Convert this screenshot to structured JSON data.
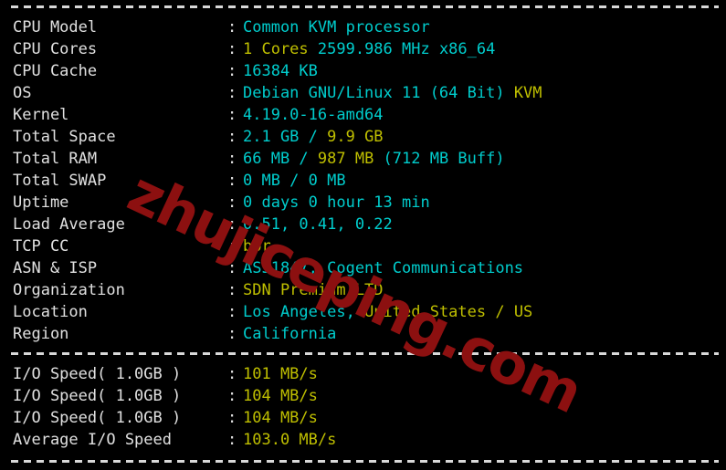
{
  "terminal": {
    "background": "#000000",
    "colors": {
      "label": "#e0e0e0",
      "cyan": "#00cdcd",
      "yellow": "#bfbf00",
      "watermark": "#8c1010"
    },
    "separator_char": "-",
    "colon": ":"
  },
  "watermark": {
    "text": "zhujiceping.com"
  },
  "system_info": [
    {
      "label": "CPU Model",
      "segments": [
        {
          "text": "Common KVM processor",
          "color": "cyan"
        }
      ]
    },
    {
      "label": "CPU Cores",
      "segments": [
        {
          "text": "1 Cores ",
          "color": "yellow"
        },
        {
          "text": "2599.986 MHz x86_64",
          "color": "cyan"
        }
      ]
    },
    {
      "label": "CPU Cache",
      "segments": [
        {
          "text": "16384 KB",
          "color": "cyan"
        }
      ]
    },
    {
      "label": "OS",
      "segments": [
        {
          "text": "Debian GNU/Linux 11 (64 Bit) ",
          "color": "cyan"
        },
        {
          "text": "KVM",
          "color": "yellow"
        }
      ]
    },
    {
      "label": "Kernel",
      "segments": [
        {
          "text": "4.19.0-16-amd64",
          "color": "cyan"
        }
      ]
    },
    {
      "label": "Total Space",
      "segments": [
        {
          "text": "2.1 GB / ",
          "color": "cyan"
        },
        {
          "text": "9.9 GB",
          "color": "yellow"
        }
      ]
    },
    {
      "label": "Total RAM",
      "segments": [
        {
          "text": "66 MB / ",
          "color": "cyan"
        },
        {
          "text": "987 MB ",
          "color": "yellow"
        },
        {
          "text": "(712 MB Buff)",
          "color": "cyan"
        }
      ]
    },
    {
      "label": "Total SWAP",
      "segments": [
        {
          "text": "0 MB / ",
          "color": "cyan"
        },
        {
          "text": "0 MB",
          "color": "cyan"
        }
      ]
    },
    {
      "label": "Uptime",
      "segments": [
        {
          "text": "0 days 0 hour 13 min",
          "color": "cyan"
        }
      ]
    },
    {
      "label": "Load Average",
      "segments": [
        {
          "text": "0.51, 0.41, 0.22",
          "color": "cyan"
        }
      ]
    },
    {
      "label": "TCP CC",
      "segments": [
        {
          "text": "bbr",
          "color": "yellow"
        }
      ]
    },
    {
      "label": "ASN & ISP",
      "segments": [
        {
          "text": "AS51847, Cogent Communications",
          "color": "cyan"
        }
      ]
    },
    {
      "label": "Organization",
      "segments": [
        {
          "text": "SDN Premium LTD",
          "color": "yellow"
        }
      ]
    },
    {
      "label": "Location",
      "segments": [
        {
          "text": "Los Angeles, ",
          "color": "cyan"
        },
        {
          "text": "United States / US",
          "color": "yellow"
        }
      ]
    },
    {
      "label": "Region",
      "segments": [
        {
          "text": "California",
          "color": "cyan"
        }
      ]
    }
  ],
  "io_results": [
    {
      "label": "I/O Speed( 1.0GB )",
      "segments": [
        {
          "text": "101 MB/s",
          "color": "yellow"
        }
      ]
    },
    {
      "label": "I/O Speed( 1.0GB )",
      "segments": [
        {
          "text": "104 MB/s",
          "color": "yellow"
        }
      ]
    },
    {
      "label": "I/O Speed( 1.0GB )",
      "segments": [
        {
          "text": "104 MB/s",
          "color": "yellow"
        }
      ]
    },
    {
      "label": "Average I/O Speed",
      "segments": [
        {
          "text": "103.0 MB/s",
          "color": "yellow"
        }
      ]
    }
  ]
}
